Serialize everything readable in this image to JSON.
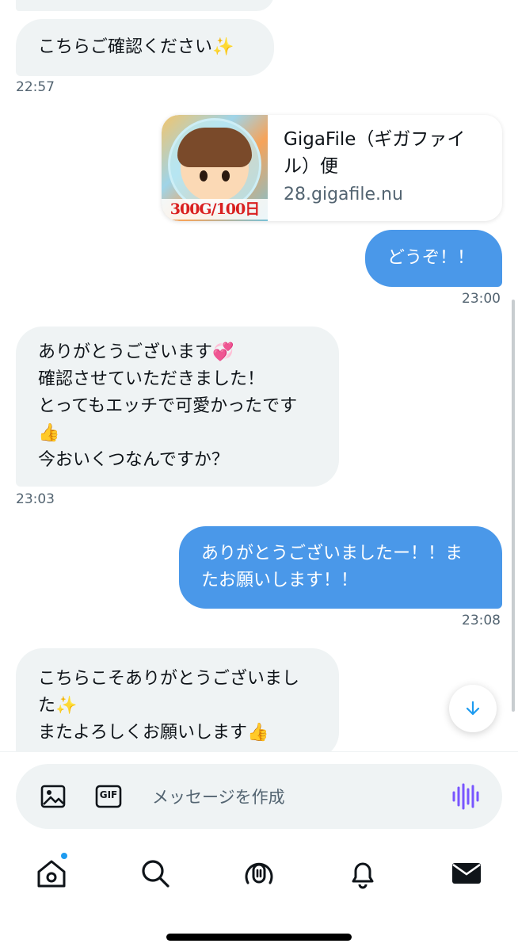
{
  "messages": [
    {
      "direction": "in",
      "lines": [
        "こちらご確認ください"
      ],
      "emoji_end": "✨",
      "time": "22:57"
    },
    {
      "direction": "out",
      "type": "link_card",
      "title": "GigaFile（ギガファイル）便",
      "title_lines": [
        "GigaFile（ギガファイ",
        "ル）便"
      ],
      "domain": "28.gigafile.nu",
      "thumbnail_caption": "300G/100日"
    },
    {
      "direction": "out",
      "lines": [
        "どうぞ！！"
      ],
      "time": "23:00"
    },
    {
      "direction": "in",
      "lines": [
        "ありがとうございます",
        "確認させていただきました！",
        "とってもエッチで可愛かったです",
        "👍",
        "今おいくつなんですか？"
      ],
      "emoji_heart": "💞",
      "time": "23:03"
    },
    {
      "direction": "out",
      "lines": [
        "ありがとうございましたー！！ま",
        "たお願いします！！"
      ],
      "time": "23:08"
    },
    {
      "direction": "in",
      "lines": [
        "こちらこそありがとうございまし",
        "た",
        "またよろしくお願いします"
      ],
      "emoji_sparkle": "✨",
      "emoji_thumb": "👍"
    }
  ],
  "composer": {
    "placeholder": "メッセージを作成",
    "image_icon": "image-icon",
    "gif_label": "GIF",
    "voice_icon": "voice-waveform-icon"
  },
  "tabbar": {
    "items": [
      "home-icon",
      "search-icon",
      "spaces-icon",
      "notifications-icon",
      "messages-icon"
    ],
    "home_has_badge": true
  },
  "colors": {
    "outgoing_bubble": "#4a98e9",
    "incoming_bubble": "#eff3f4",
    "accent": "#1d9bf0",
    "voice_icon": "#7856ff"
  }
}
